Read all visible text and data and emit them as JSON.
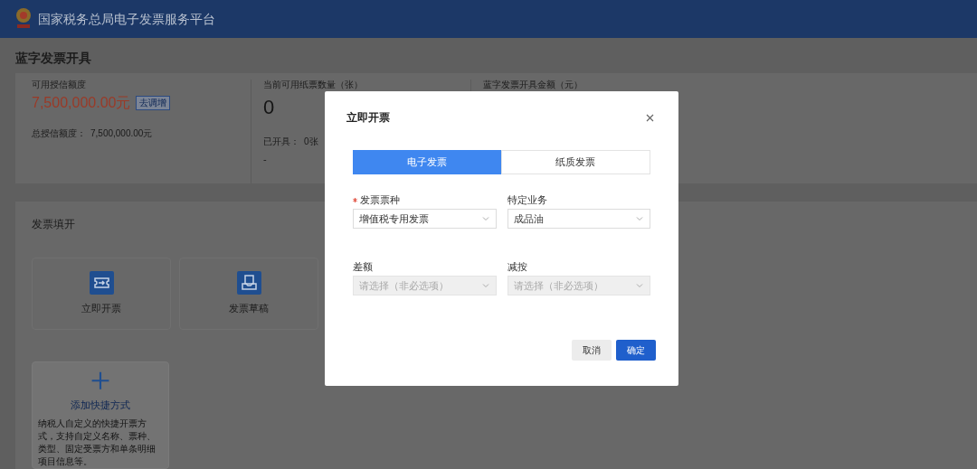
{
  "header": {
    "title": "国家税务总局电子发票服务平台"
  },
  "page_title": "蓝字发票开具",
  "stats": [
    {
      "label": "可用授信额度",
      "value": "7,500,000.00元",
      "kind": "amount",
      "action": "去调增",
      "detail_label": "总授信额度：",
      "detail_value": "7,500,000.00元"
    },
    {
      "label": "当前可用纸票数量（张）",
      "value": "0",
      "kind": "count",
      "detail_label": "已开具：",
      "detail_value": "0张",
      "extra": "-"
    },
    {
      "label": "蓝字发票开具金额（元）",
      "kind": "plain"
    }
  ],
  "section": {
    "title": "发票填开",
    "tiles": [
      {
        "label": "立即开票"
      },
      {
        "label": "发票草稿"
      }
    ],
    "add_tile": {
      "label": "添加快捷方式",
      "description": "纳税人自定义的快捷开票方式，支持自定义名称、票种、类型、固定受票方和单条明细项目信息等。"
    }
  },
  "dialog": {
    "title": "立即开票",
    "tabs": [
      {
        "label": "电子发票",
        "selected": true
      },
      {
        "label": "纸质发票",
        "selected": false
      }
    ],
    "fields": [
      {
        "label": "发票票种",
        "required": true,
        "value": "增值税专用发票",
        "disabled": false
      },
      {
        "label": "特定业务",
        "required": false,
        "value": "成品油",
        "disabled": false
      },
      {
        "label": "差额",
        "required": false,
        "placeholder": "请选择（非必选项）",
        "disabled": true
      },
      {
        "label": "减按",
        "required": false,
        "placeholder": "请选择（非必选项）",
        "disabled": true
      }
    ],
    "buttons": [
      {
        "label": "取消",
        "kind": "secondary"
      },
      {
        "label": "确定",
        "kind": "primary"
      }
    ]
  }
}
